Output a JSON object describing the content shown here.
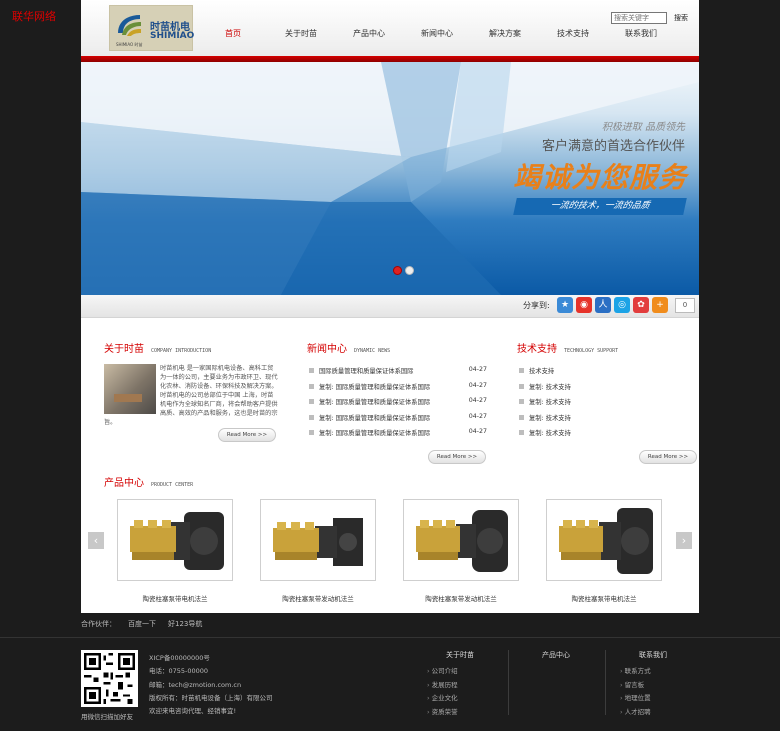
{
  "watermark": "联华网络",
  "logo": {
    "cn": "时苗机电",
    "en": "SHIMIAO",
    "small": "SHIMIAO 时苗"
  },
  "nav": [
    "首页",
    "关于时苗",
    "产品中心",
    "新闻中心",
    "解决方案",
    "技术支持",
    "联系我们"
  ],
  "search": {
    "placeholder": "搜索关键字",
    "button": "搜索"
  },
  "banner": {
    "slogan1": "积极进取 品质领先",
    "slogan2": "客户满意的首选合作伙伴",
    "slogan3": "竭诚为您服务",
    "slogan4": "一流的技术，一流的品质"
  },
  "share": {
    "label": "分享到:",
    "count": "0"
  },
  "about": {
    "title": "关于时苗",
    "subtitle": "COMPANY INTRODUCTION",
    "text": "时苗机电 是一家国际机电设备、高科工贸为一体的公司，主要业务为市政环卫、现代化农林、消防设备、环保科技及解决方案。时苗机电的公司总部位于中国 上海，时苗机电作为全球知名厂商，将会帮助客户提供高质、高效的产品和服务，这也是时苗的宗旨。",
    "readmore": "Read More >>"
  },
  "news": {
    "title": "新闻中心",
    "subtitle": "DYNAMIC NEWS",
    "items": [
      {
        "title": "国际质量管理和质量保证体系国际",
        "date": "04-27"
      },
      {
        "title": "复制: 国际质量管理和质量保证体系国际",
        "date": "04-27"
      },
      {
        "title": "复制: 国际质量管理和质量保证体系国际",
        "date": "04-27"
      },
      {
        "title": "复制: 国际质量管理和质量保证体系国际",
        "date": "04-27"
      },
      {
        "title": "复制: 国际质量管理和质量保证体系国际",
        "date": "04-27"
      }
    ],
    "readmore": "Read More >>"
  },
  "tech": {
    "title": "技术支持",
    "subtitle": "TECHNOLOGY SUPPORT",
    "items": [
      "技术支持",
      "复制: 技术支持",
      "复制: 技术支持",
      "复制: 技术支持",
      "复制: 技术支持"
    ],
    "readmore": "Read More >>"
  },
  "products": {
    "title": "产品中心",
    "subtitle": "PRODUCT CENTER",
    "items": [
      "陶瓷柱塞泵带电机法兰",
      "陶瓷柱塞泵带发动机法兰",
      "陶瓷柱塞泵带发动机法兰",
      "陶瓷柱塞泵带电机法兰"
    ],
    "prev": "‹",
    "next": "›"
  },
  "partners": {
    "label": "合作伙伴：",
    "links": [
      "百度一下",
      "好123导航"
    ]
  },
  "footer": {
    "qr_caption": "用微信扫描加好友",
    "info": [
      "XICP备00000000号",
      "电话：0755-00000",
      "邮箱：tech@zmotion.com.cn",
      "版权所有：时苗机电设备（上海）有限公司",
      "欢迎来电咨询代理、经销事宜!"
    ],
    "columns": [
      {
        "title": "关于时苗",
        "links": [
          "公司介绍",
          "发展历程",
          "企业文化",
          "资质荣誉"
        ]
      },
      {
        "title": "产品中心",
        "links": []
      },
      {
        "title": "联系我们",
        "links": [
          "联系方式",
          "留言板",
          "地理位置",
          "人才招聘"
        ]
      }
    ]
  },
  "colors": {
    "accent": "#d40000",
    "footer_bg": "#1c1c1c",
    "banner_blue": "#0b5aa6",
    "slogan_orange": "#e8801a"
  }
}
